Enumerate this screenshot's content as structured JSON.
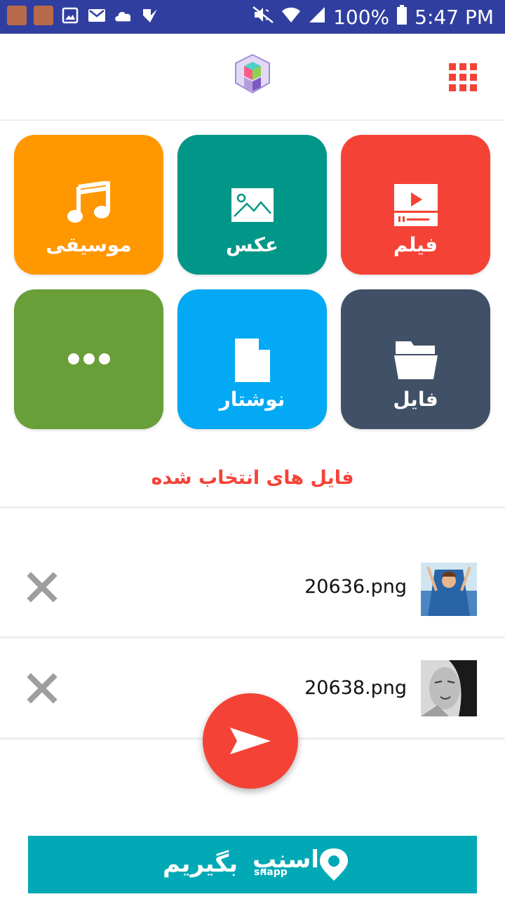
{
  "status_bar": {
    "battery_percent": "100%",
    "time": "5:47 PM",
    "icons": [
      "avatar-icon",
      "avatar-icon",
      "image-icon",
      "mail-icon",
      "cloud-icon",
      "check-icon",
      "mute-icon",
      "wifi-icon",
      "signal-icon",
      "battery-icon"
    ]
  },
  "toolbar": {
    "logo": "cube-logo",
    "menu_icon": "grid-icon"
  },
  "categories": [
    {
      "label": "موسیقی",
      "icon": "music-note-icon",
      "color": "#ff9800"
    },
    {
      "label": "عکس",
      "icon": "image-icon",
      "color": "#009688"
    },
    {
      "label": "فیلم",
      "icon": "video-icon",
      "color": "#f44336"
    },
    {
      "label": "",
      "icon": "more-icon",
      "color": "#689f38"
    },
    {
      "label": "نوشتار",
      "icon": "document-icon",
      "color": "#03a9f4"
    },
    {
      "label": "فایل",
      "icon": "folder-icon",
      "color": "#405066"
    }
  ],
  "selected_section": {
    "title": "فایل های انتخاب شده",
    "color": "#f44336"
  },
  "selected_files": [
    {
      "name": "20636.png",
      "thumb": "photo-thumb-blue"
    },
    {
      "name": "20638.png",
      "thumb": "photo-thumb-bw"
    }
  ],
  "send_button": {
    "icon": "send-icon",
    "color": "#f44336"
  },
  "ad": {
    "text": "بگیریم",
    "brand": "اسنپ",
    "brand_sub": "snapp",
    "color": "#00a9b5"
  }
}
